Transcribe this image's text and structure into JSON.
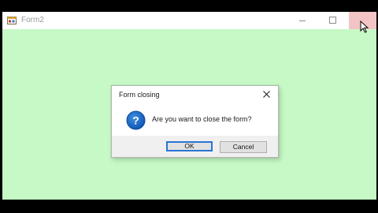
{
  "window": {
    "title": "Form2",
    "client_color": "#c6f9c5",
    "close_hover_color": "#f3c4c6"
  },
  "dialog": {
    "title": "Form closing",
    "message": "Are you want to close the form?",
    "icon": "question-icon",
    "ok_label": "OK",
    "cancel_label": "Cancel"
  }
}
